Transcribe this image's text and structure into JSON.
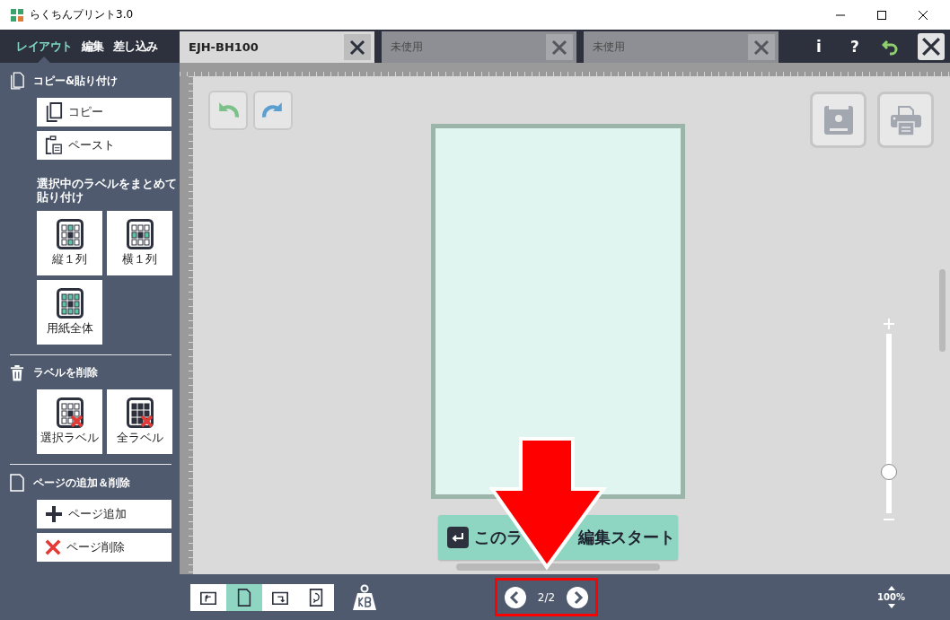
{
  "window": {
    "title": "らくちんプリント3.0"
  },
  "mode_tabs": [
    {
      "label": "レイアウト",
      "selected": true
    },
    {
      "label": "編集",
      "selected": false
    },
    {
      "label": "差し込み",
      "selected": false
    }
  ],
  "document_tabs": [
    {
      "label": "EJH-BH100",
      "selected": true
    },
    {
      "label": "未使用",
      "selected": false
    },
    {
      "label": "未使用",
      "selected": false
    }
  ],
  "toolbar": {
    "info": "i",
    "help": "?"
  },
  "sidebar": {
    "sections": [
      {
        "kind": "copy",
        "title": "コピー&貼り付け",
        "buttons": [
          {
            "kind": "copy",
            "label": "コピー"
          },
          {
            "kind": "paste",
            "label": "ペースト"
          }
        ],
        "subheading": "選択中のラベルをまとめて貼り付け",
        "tiles": [
          {
            "kind": "column",
            "label": "縦１列"
          },
          {
            "kind": "row",
            "label": "横１列"
          },
          {
            "kind": "sheet",
            "label": "用紙全体"
          }
        ]
      },
      {
        "kind": "delete",
        "title": "ラベルを削除",
        "tiles": [
          {
            "kind": "delete-selected",
            "label": "選択ラベル"
          },
          {
            "kind": "delete-all",
            "label": "全ラベル"
          }
        ]
      },
      {
        "kind": "page",
        "title": "ページの追加＆削除",
        "buttons": [
          {
            "kind": "add",
            "label": "ページ追加"
          },
          {
            "kind": "remove",
            "label": "ページ削除"
          }
        ]
      }
    ]
  },
  "start_button": {
    "visible_parts": [
      "このラ",
      "編集スタート"
    ]
  },
  "zoom": {
    "level": 0.23,
    "reading": "100%"
  },
  "orientation_buttons": [
    {
      "kind": "rotate-left",
      "selected": false
    },
    {
      "kind": "portrait",
      "selected": true
    },
    {
      "kind": "rotate-right",
      "selected": false
    },
    {
      "kind": "flip",
      "selected": false
    }
  ],
  "page_nav": {
    "reading": "2/2"
  },
  "annotations": {
    "arrow": true,
    "highlight": true
  }
}
